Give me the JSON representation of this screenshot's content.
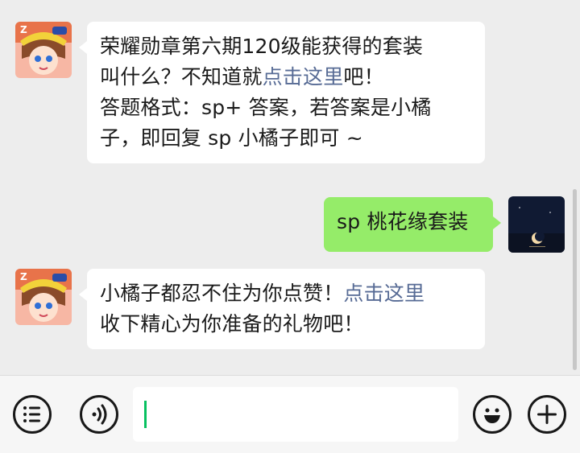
{
  "messages": [
    {
      "side": "left",
      "avatar": "qq-speed-game-avatar",
      "lines": [
        [
          {
            "t": "荣耀勋章第六期120级能获得的套装"
          }
        ],
        [
          {
            "t": "叫什么？不知道就"
          },
          {
            "t": "点击这里",
            "link": true
          },
          {
            "t": "吧！"
          }
        ],
        [
          {
            "t": "答题格式：sp+ 答案，若答案是小橘"
          }
        ],
        [
          {
            "t": "子，即回复 sp 小橘子即可 ~"
          }
        ]
      ]
    },
    {
      "side": "right",
      "avatar": "moon-night-avatar",
      "lines": [
        [
          {
            "t": "sp 桃花缘套装"
          }
        ]
      ]
    },
    {
      "side": "left",
      "avatar": "qq-speed-game-avatar",
      "lines": [
        [
          {
            "t": "小橘子都忍不住为你点赞！"
          },
          {
            "t": "点击这里",
            "link": true
          }
        ],
        [
          {
            "t": "收下精心为你准备的礼物吧！"
          }
        ]
      ]
    }
  ],
  "input_bar": {
    "menu_icon": "list-menu-icon",
    "voice_icon": "voice-icon",
    "text_value": "",
    "emoji_icon": "emoji-icon",
    "add_icon": "plus-icon"
  },
  "colors": {
    "background": "#ededed",
    "bubble_received": "#ffffff",
    "bubble_sent": "#95ec69",
    "link": "#576b95",
    "caret": "#07c160"
  }
}
